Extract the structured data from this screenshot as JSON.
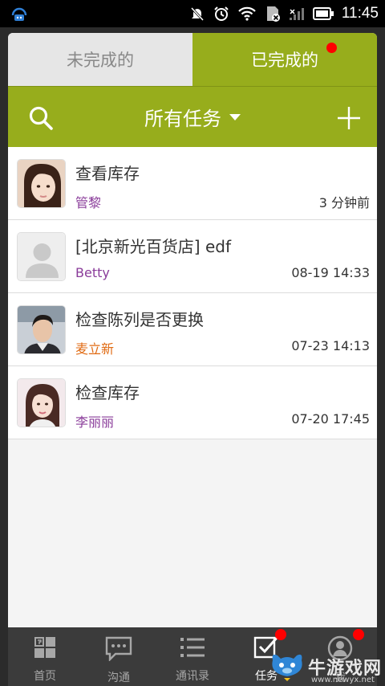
{
  "status_bar": {
    "time": "11:45",
    "icons": [
      "app-notification-icon",
      "mute-icon",
      "alarm-icon",
      "wifi-icon",
      "sim-icon",
      "signal-icon",
      "battery-icon"
    ]
  },
  "tabs": [
    {
      "label": "未完成的",
      "active": false
    },
    {
      "label": "已完成的",
      "active": true,
      "has_badge": true
    }
  ],
  "toolbar": {
    "title": "所有任务",
    "icons": [
      "search-icon",
      "add-icon"
    ]
  },
  "tasks": [
    {
      "title": "查看库存",
      "assignee": "管黎",
      "assignee_color": "#8a3c9a",
      "time": "3 分钟前",
      "avatar": "avatar-girl-1"
    },
    {
      "title": "[北京新光百货店] edf",
      "assignee": "Betty",
      "assignee_color": "#8a3c9a",
      "time": "08-19 14:33",
      "avatar": "avatar-default"
    },
    {
      "title": "检查陈列是否更换",
      "assignee": "麦立新",
      "assignee_color": "#e06a12",
      "time": "07-23 14:13",
      "avatar": "avatar-boy"
    },
    {
      "title": "检查库存",
      "assignee": "李丽丽",
      "assignee_color": "#8a3c9a",
      "time": "07-20 17:45",
      "avatar": "avatar-girl-2"
    }
  ],
  "bottom_nav": [
    {
      "label": "首页",
      "icon": "home-grid-icon",
      "active": false
    },
    {
      "label": "沟通",
      "icon": "chat-icon",
      "active": false
    },
    {
      "label": "通讯录",
      "icon": "contacts-list-icon",
      "active": false
    },
    {
      "label": "任务",
      "icon": "task-check-icon",
      "active": true,
      "has_badge": true
    },
    {
      "label": "我",
      "icon": "profile-icon",
      "active": false,
      "has_badge": true
    }
  ],
  "watermark": {
    "text": "牛游戏网",
    "sub": "www.newyx.net"
  },
  "colors": {
    "accent": "#97ad1c",
    "badge": "#ff0000",
    "nav_bg": "#3b3b3b"
  }
}
